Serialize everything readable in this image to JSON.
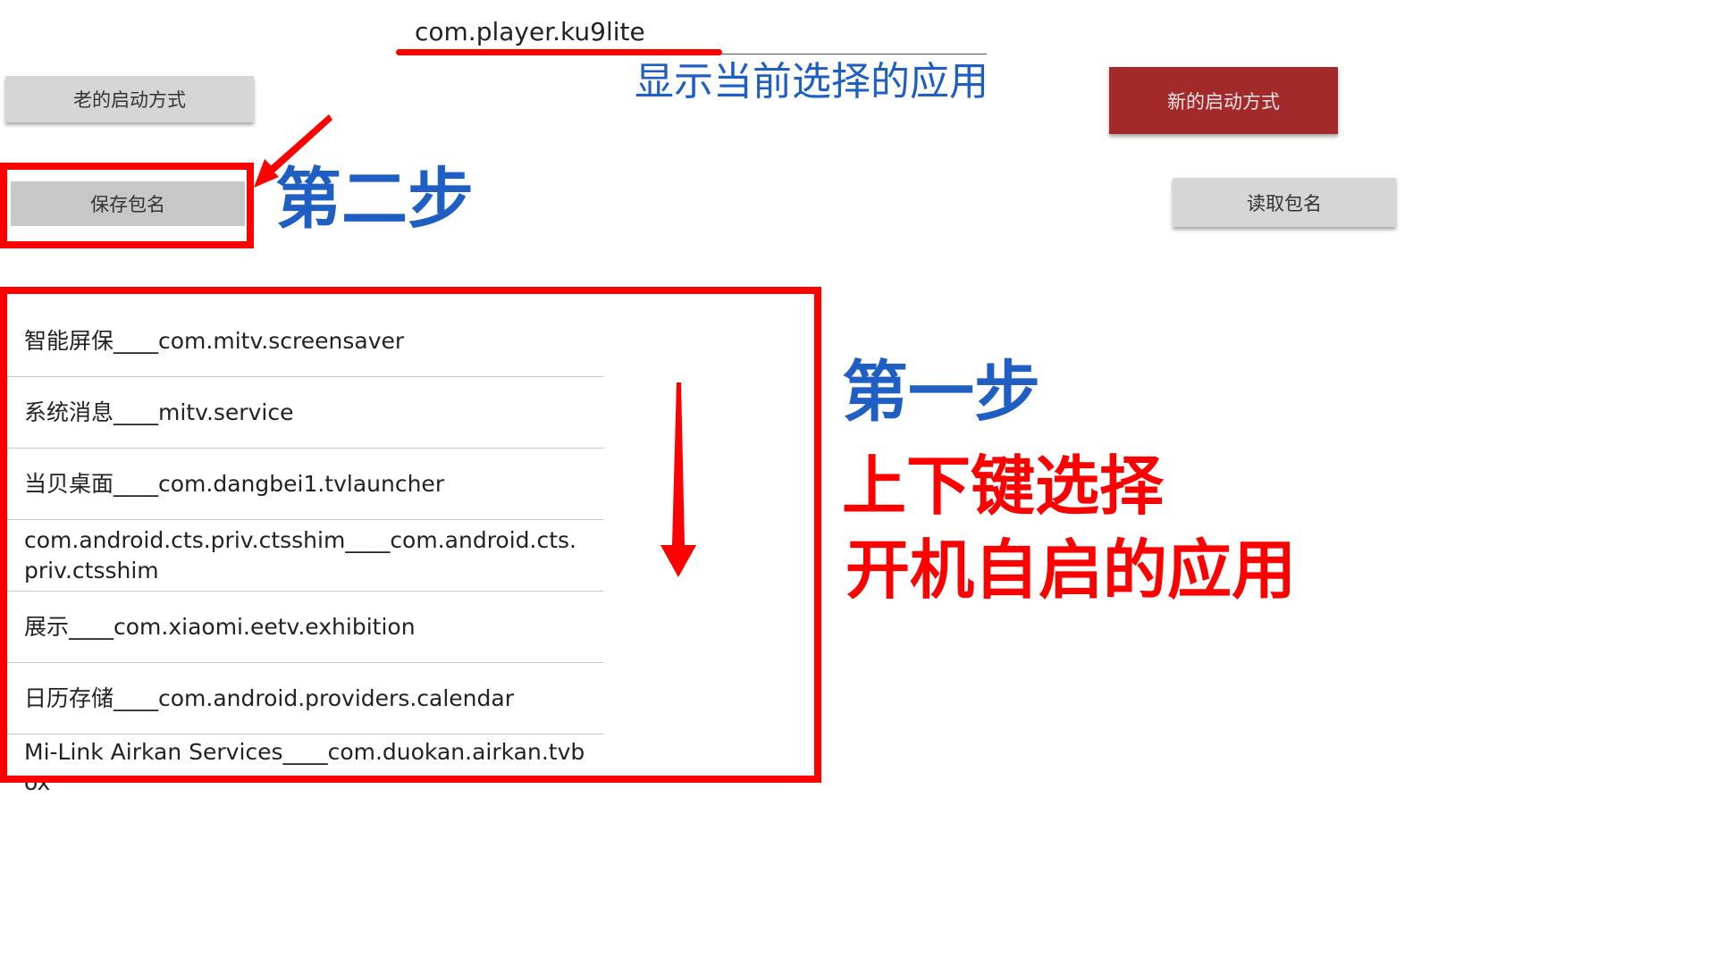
{
  "current_package": "com.player.ku9lite",
  "buttons": {
    "old_launch": "老的启动方式",
    "save_package": "保存包名",
    "new_launch": "新的启动方式",
    "read_package": "读取包名"
  },
  "annotations": {
    "show_current": "显示当前选择的应用",
    "step_two": "第二步",
    "step_one": "第一步",
    "up_down_select": "上下键选择",
    "autostart_app": "开机自启的应用"
  },
  "app_list": [
    "智能屏保____com.mitv.screensaver",
    "系统消息____mitv.service",
    "当贝桌面____com.dangbei1.tvlauncher",
    "com.android.cts.priv.ctsshim____com.android.cts.priv.ctsshim",
    "展示____com.xiaomi.eetv.exhibition",
    "日历存储____com.android.providers.calendar",
    "Mi-Link Airkan Services____com.duokan.airkan.tvbox"
  ],
  "colors": {
    "annotation_red": "#ff0000",
    "annotation_blue": "#1f5fc4",
    "new_button_bg": "#a22a2a",
    "gray_button_bg": "#d6d6d6"
  }
}
